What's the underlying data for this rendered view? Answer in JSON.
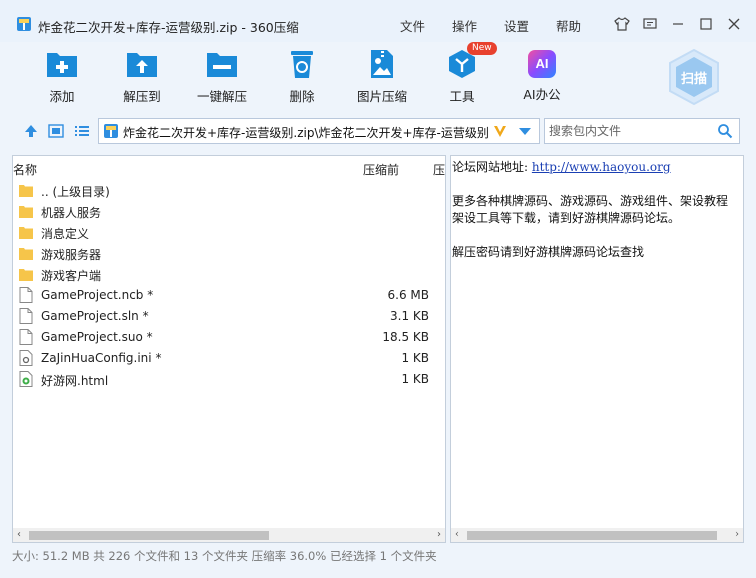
{
  "window": {
    "title": "炸金花二次开发+库存-运营级别.zip - 360压缩",
    "menus": [
      "文件",
      "操作",
      "设置",
      "帮助"
    ]
  },
  "toolbar": {
    "items": [
      {
        "label": "添加",
        "icon": "add-icon"
      },
      {
        "label": "解压到",
        "icon": "extract-to-icon"
      },
      {
        "label": "一键解压",
        "icon": "one-click-extract-icon"
      },
      {
        "label": "删除",
        "icon": "delete-icon"
      },
      {
        "label": "图片压缩",
        "icon": "image-compress-icon"
      },
      {
        "label": "工具",
        "icon": "tools-icon",
        "badge": "New"
      },
      {
        "label": "AI办公",
        "icon": "ai-icon",
        "icon_text": "AI"
      }
    ],
    "scan_label": "扫描"
  },
  "address": {
    "path": "炸金花二次开发+库存-运营级别.zip\\炸金花二次开发+库存-运营级别"
  },
  "search": {
    "placeholder": "搜索包内文件"
  },
  "file_list": {
    "columns": [
      "名称",
      "压缩前",
      "压"
    ],
    "rows": [
      {
        "name": ".. (上级目录)",
        "size": "",
        "type": "folder"
      },
      {
        "name": "机器人服务",
        "size": "",
        "type": "folder"
      },
      {
        "name": "消息定义",
        "size": "",
        "type": "folder"
      },
      {
        "name": "游戏服务器",
        "size": "",
        "type": "folder"
      },
      {
        "name": "游戏客户端",
        "size": "",
        "type": "folder"
      },
      {
        "name": "GameProject.ncb *",
        "size": "6.6 MB",
        "type": "file"
      },
      {
        "name": "GameProject.sln *",
        "size": "3.1 KB",
        "type": "file"
      },
      {
        "name": "GameProject.suo *",
        "size": "18.5 KB",
        "type": "file"
      },
      {
        "name": "ZaJinHuaConfig.ini *",
        "size": "1 KB",
        "type": "ini"
      },
      {
        "name": "好游网.html",
        "size": "1 KB",
        "type": "html"
      }
    ]
  },
  "preview": {
    "site_label": "论坛网站地址:",
    "site_url": "http://www.haoyou.org",
    "line2": "更多各种棋牌源码、游戏源码、游戏组件、架设教程",
    "line3": "架设工具等下载，请到好游棋牌源码论坛。",
    "line4": "解压密码请到好游棋牌源码论坛查找"
  },
  "status": {
    "text": "大小: 51.2 MB 共 226 个文件和 13 个文件夹 压缩率 36.0% 已经选择 1 个文件夹"
  },
  "colors": {
    "accent": "#1a8ad8",
    "title_bg": "#eaf2fb",
    "folder": "#f6c54a"
  }
}
